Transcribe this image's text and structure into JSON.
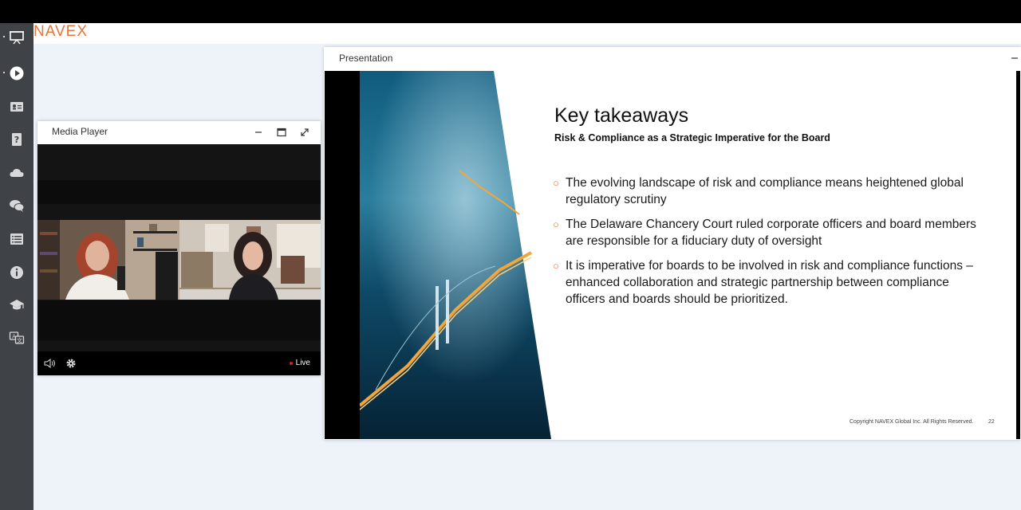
{
  "brand": {
    "logo_text": "NAVEX"
  },
  "sidebar": {
    "items": [
      {
        "icon": "presentation-icon"
      },
      {
        "icon": "play-icon"
      },
      {
        "icon": "contact-card-icon"
      },
      {
        "icon": "help-icon"
      },
      {
        "icon": "cloud-icon"
      },
      {
        "icon": "chat-icon"
      },
      {
        "icon": "list-icon"
      },
      {
        "icon": "info-icon"
      },
      {
        "icon": "graduation-cap-icon"
      },
      {
        "icon": "translate-icon"
      }
    ]
  },
  "media_player": {
    "title": "Media Player",
    "live_label": "Live"
  },
  "presentation": {
    "title": "Presentation",
    "slide": {
      "title": "Key takeaways",
      "subtitle": "Risk & Compliance as a Strategic Imperative for the Board",
      "bullets": [
        "The evolving landscape of risk and compliance means heightened global regulatory scrutiny",
        "The Delaware Chancery Court ruled corporate officers and board members are responsible for a fiduciary duty of oversight",
        "It is imperative for boards to be involved in risk and compliance functions – enhanced collaboration and strategic partnership between compliance officers and boards should be prioritized."
      ],
      "footer": "Copyright NAVEX Global Inc. All Rights Reserved.",
      "page": "22"
    }
  },
  "colors": {
    "accent": "#e8743b",
    "sidebar": "#3f4347",
    "background": "#eef2f9"
  }
}
